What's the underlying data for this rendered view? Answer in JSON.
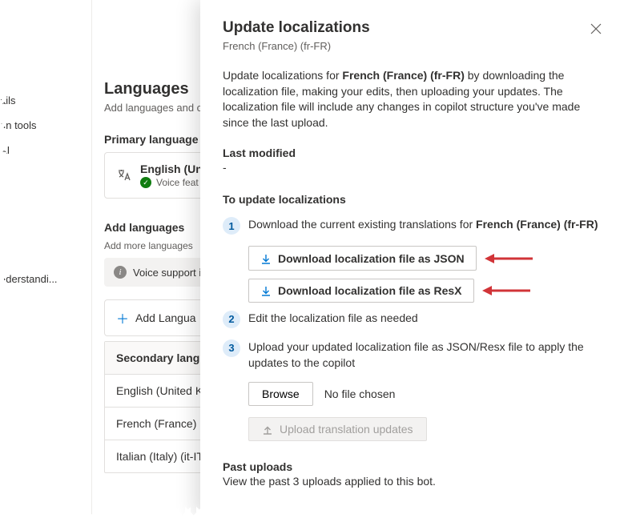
{
  "sidebar": {
    "items": [
      "ails",
      "on tools",
      "AI",
      "nderstandi..."
    ]
  },
  "mid": {
    "title": "Languages",
    "subtitle": "Add languages and c",
    "primary_label": "Primary language",
    "primary_lang": "English (Unit",
    "voice_feat": "Voice feat",
    "add_lang_label": "Add languages",
    "add_lang_sub": "Add more languages",
    "info_text": "Voice support is ",
    "add_button": "Add Langua",
    "secondary_label": "Secondary langua",
    "secondary_langs": [
      "English (United Kin",
      "French (France) (fr-",
      "Italian (Italy) (it-IT)"
    ]
  },
  "flyout": {
    "title": "Update localizations",
    "subtitle": "French (France) (fr-FR)",
    "para_pre": "Update localizations for ",
    "para_bold": "French (France) (fr-FR)",
    "para_post": " by downloading the localization file, making your edits, then uploading your updates. The localization file will include any changes in copilot structure you've made since the last upload.",
    "last_modified_label": "Last modified",
    "last_modified_value": "-",
    "steps_header": "To update localizations",
    "step1_pre": "Download the current existing translations for ",
    "step1_bold": "French (France) (fr-FR)",
    "download_json": "Download localization file as JSON",
    "download_resx": "Download localization file as ResX",
    "step2": "Edit the localization file as needed",
    "step3": "Upload your updated localization file as JSON/Resx file to apply the updates to the copilot",
    "browse": "Browse",
    "file_status": "No file chosen",
    "upload_btn": "Upload translation updates",
    "past_header": "Past uploads",
    "past_sub": "View the past 3 uploads applied to this bot."
  }
}
